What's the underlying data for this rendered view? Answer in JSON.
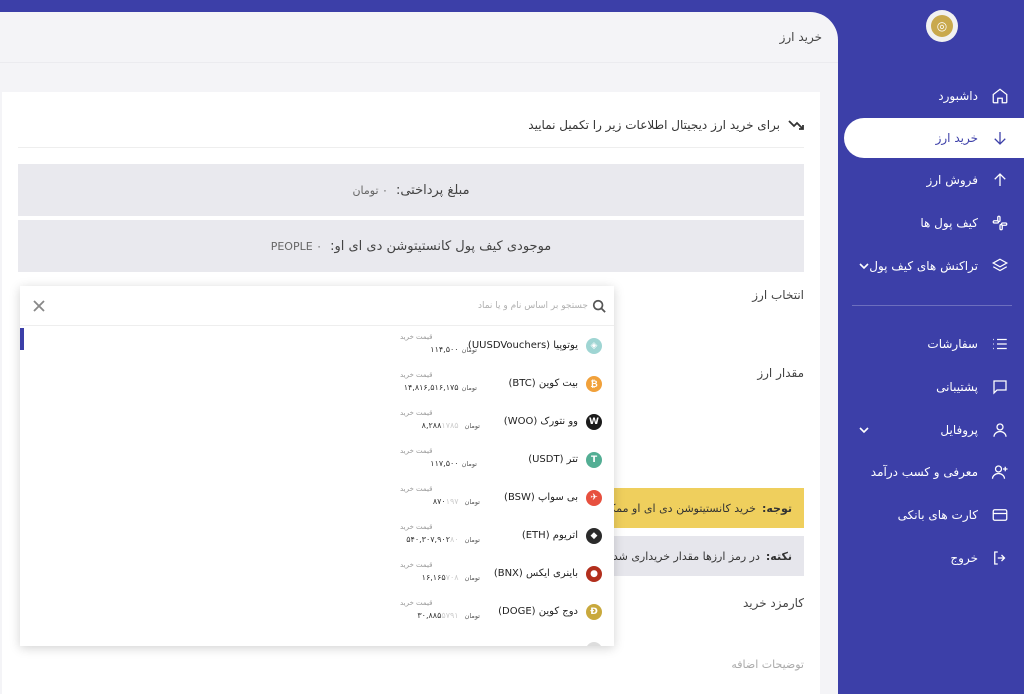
{
  "page": {
    "heading": "خرید ارز",
    "intro": "برای خرید ارز دیجیتال اطلاعات زیر را تکمیل نمایید",
    "payment_label": "مبلغ پرداختی:",
    "payment_value": "۰ تومان",
    "wallet_label": "موجودی کیف پول کانستیتوشن دی ای او:",
    "wallet_value": "PEOPLE ۰",
    "select_currency_label": "انتخاب ارز",
    "amount_label": "مقدار ارز",
    "warn_title": "توجه:",
    "warn_text": "خرید کانستیتوشن دی ای او ممکن",
    "tip_title": "نکته:",
    "tip_text": "در رمز ارزها مقدار خریداری شده",
    "fee_label": "کارمزد خرید",
    "extra_desc_placeholder": "توضیحات اضافه"
  },
  "sidebar": {
    "items": [
      {
        "label": "داشبورد",
        "icon": "home-icon"
      },
      {
        "label": "خرید ارز",
        "icon": "arrow-down-icon"
      },
      {
        "label": "فروش ارز",
        "icon": "arrow-up-icon"
      },
      {
        "label": "کیف پول ها",
        "icon": "slack-icon"
      },
      {
        "label": "تراکنش های کیف پول",
        "icon": "layers-icon"
      },
      {
        "label": "سفارشات",
        "icon": "list-icon"
      },
      {
        "label": "پشتیبانی",
        "icon": "message-icon"
      },
      {
        "label": "پروفایل",
        "icon": "user-icon"
      },
      {
        "label": "معرفی و کسب درآمد",
        "icon": "user-plus-icon"
      },
      {
        "label": "کارت های بانکی",
        "icon": "credit-card-icon"
      },
      {
        "label": "خروج",
        "icon": "logout-icon"
      }
    ]
  },
  "dropdown": {
    "search_placeholder": "جستجو بر اساس نام و یا نماد",
    "price_label": "قیمت خرید",
    "unit": "تومان",
    "coins": [
      {
        "name": "یوتوپیا (UUSDVouchers)",
        "price": "۱۱۴,۵۰۰",
        "strike": "",
        "color": "#9fd5d3",
        "glyph": "◈"
      },
      {
        "name": "بیت کوین (BTC)",
        "price": "۱۴,۸۱۶,۵۱۶,۱۷۵",
        "strike": "",
        "color": "#f1a13b",
        "glyph": "₿"
      },
      {
        "name": "وو نتورک (WOO)",
        "price": "۸,۲۸۸",
        "strike": "۱۷۸۵",
        "color": "#1b1b1b",
        "glyph": "W"
      },
      {
        "name": "تتر (USDT)",
        "price": "۱۱۷,۵۰۰",
        "strike": "",
        "color": "#53ae94",
        "glyph": "T"
      },
      {
        "name": "بی سواپ (BSW)",
        "price": "۸۷۰",
        "strike": "۱۹۷",
        "color": "#e7503f",
        "glyph": "✈"
      },
      {
        "name": "اتریوم (ETH)",
        "price": "۵۴۰,۳۰۷,۹۰۲",
        "strike": "۸۰",
        "color": "#2b2b2b",
        "glyph": "◆"
      },
      {
        "name": "باینری ایکس (BNX)",
        "price": "۱۶,۱۶۵",
        "strike": "۷۰۸",
        "color": "#b22f1d",
        "glyph": "●"
      },
      {
        "name": "دوج کوین (DOGE)",
        "price": "۳۰,۸۸۵",
        "strike": "۵۷۹۱",
        "color": "#c9a93d",
        "glyph": "Ð"
      },
      {
        "name": "",
        "price": "",
        "strike": "",
        "color": "#dddddd",
        "glyph": ""
      }
    ]
  }
}
